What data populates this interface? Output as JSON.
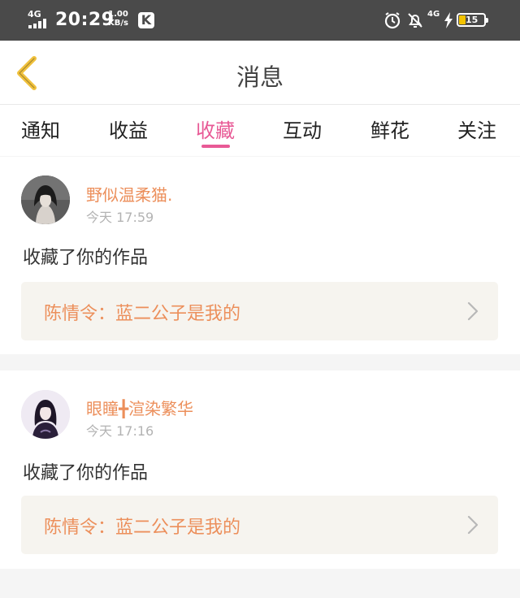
{
  "status_bar": {
    "network": "4G",
    "time": "20:29",
    "speed_value": "1.00",
    "speed_unit": "KB/s",
    "app_badge": "K",
    "network2": "4G",
    "battery": "15",
    "icons": [
      "alarm-icon",
      "mute-bell-icon",
      "charging-icon"
    ]
  },
  "header": {
    "title": "消息",
    "back_icon": "chevron-left-icon"
  },
  "tabs": [
    {
      "label": "通知"
    },
    {
      "label": "收益"
    },
    {
      "label": "收藏",
      "active": true
    },
    {
      "label": "互动"
    },
    {
      "label": "鲜花"
    },
    {
      "label": "关注"
    }
  ],
  "items": [
    {
      "user": "野似温柔猫.",
      "time": "今天 17:59",
      "action": "收藏了你的作品",
      "work": "陈情令：蓝二公子是我的"
    },
    {
      "user": "眼瞳╋渲染繁华",
      "time": "今天 17:16",
      "action": "收藏了你的作品",
      "work": "陈情令：蓝二公子是我的"
    }
  ],
  "colors": {
    "accent": "#e85a96",
    "username": "#ec8f5b",
    "back_arrow": "#f0c13c",
    "status_bar": "#4a4a4a"
  }
}
